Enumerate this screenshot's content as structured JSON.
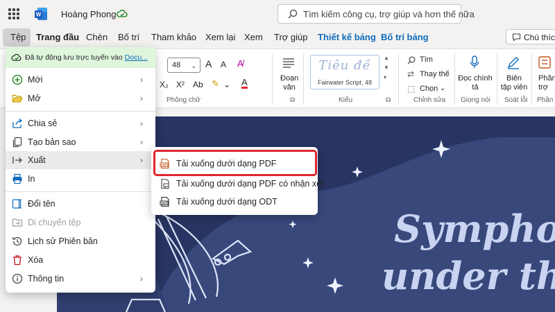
{
  "titlebar": {
    "user_name": "Hoàng Phong",
    "search_placeholder": "Tìm kiếm công cụ, trợ giúp và hơn thế nữa"
  },
  "tabs": [
    {
      "label": "Tệp"
    },
    {
      "label": "Trang đầu"
    },
    {
      "label": "Chèn"
    },
    {
      "label": "Bố trí"
    },
    {
      "label": "Tham khảo"
    },
    {
      "label": "Xem lại"
    },
    {
      "label": "Xem"
    },
    {
      "label": "Trợ giúp"
    },
    {
      "label": "Thiết kế bảng"
    },
    {
      "label": "Bố trí bảng"
    }
  ],
  "comment_button": "Chú thích",
  "ribbon": {
    "font_size": "48",
    "font_group": "Phông chữ",
    "paragraph": "Đoạn văn",
    "style_preview": "Tiêu đề",
    "style_name": "Fairwater Script, 48",
    "styles_group": "Kiểu",
    "find": "Tìm",
    "replace": "Thay thế",
    "select": "Chọn",
    "editing_group": "Chỉnh sửa",
    "dictate": "Đọc chính tả",
    "voice_group": "Giọng nói",
    "editor": "Biên tập viên",
    "proofing_group": "Soát lỗi",
    "sensitivity_short": "Phần trợ",
    "sensitivity_group": "Phần b"
  },
  "file_menu": {
    "autosave_text": "Đã tự động lưu trực tuyến vào",
    "autosave_link": "Docu...",
    "items": [
      {
        "label": "Mới",
        "icon": "plus-circle-icon"
      },
      {
        "label": "Mở",
        "icon": "folder-open-icon"
      },
      {
        "label": "Chia sẻ",
        "icon": "share-icon"
      },
      {
        "label": "Tạo bản sao",
        "icon": "copy-icon"
      },
      {
        "label": "Xuất",
        "icon": "export-icon"
      },
      {
        "label": "In",
        "icon": "printer-icon"
      },
      {
        "label": "Đổi tên",
        "icon": "rename-icon"
      },
      {
        "label": "Di chuyển tệp",
        "icon": "move-folder-icon"
      },
      {
        "label": "Lịch sử Phiên bản",
        "icon": "history-icon"
      },
      {
        "label": "Xóa",
        "icon": "trash-icon"
      },
      {
        "label": "Thông tin",
        "icon": "info-icon"
      }
    ]
  },
  "export_submenu": {
    "items": [
      {
        "label": "Tải xuống dưới dạng PDF",
        "icon": "pdf-file-icon"
      },
      {
        "label": "Tải xuống dưới dạng PDF có nhận xét",
        "icon": "pdf-comment-icon"
      },
      {
        "label": "Tải xuống dưới dạng ODT",
        "icon": "odt-file-icon"
      }
    ]
  },
  "document": {
    "title_line1": "Symphony",
    "title_line2": "under the"
  },
  "colors": {
    "accent_blue": "#0f6cbd",
    "doc_background": "#283462",
    "highlight_red": "#e0262f",
    "autosave_green": "#dff6dd"
  }
}
